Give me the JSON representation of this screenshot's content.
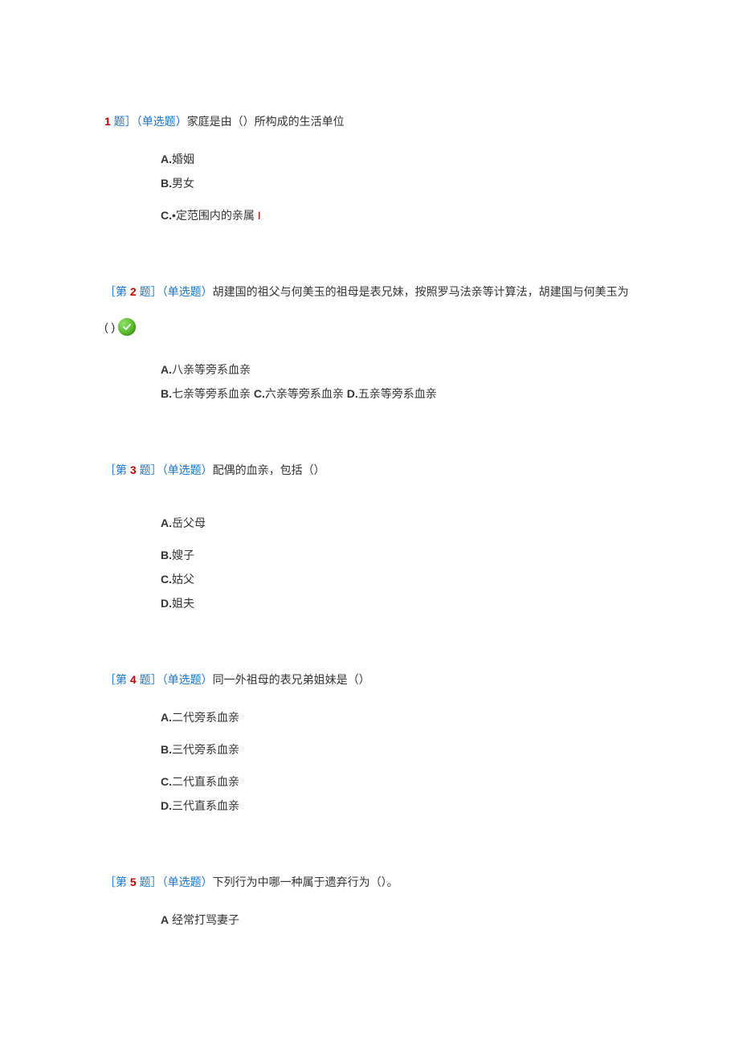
{
  "questions": [
    {
      "number_prefix": "",
      "number": "1",
      "number_suffix": " 题］（",
      "type": "单选题",
      "type_close": "）",
      "text": "家庭是由（）所构成的生活单位",
      "layout": "block",
      "options": [
        {
          "label": "A.",
          "text": "婚姻"
        },
        {
          "label": "B.",
          "text": "男女"
        },
        {
          "label": "C.",
          "text": "•定范围内的亲属",
          "trail": " I"
        }
      ]
    },
    {
      "number_prefix": "［第 ",
      "number": "2",
      "number_suffix": " 题］（",
      "type": "单选题",
      "type_close": "）",
      "text": "胡建国的祖父与何美玉的祖母是表兄妹，按照罗马法亲等计算法，胡建国与何美玉为",
      "check": true,
      "paren": "( )",
      "layout": "mixed",
      "options": [
        {
          "label": "A.",
          "text": "八亲等旁系血亲"
        },
        {
          "label": "B.",
          "text": "七亲等旁系血亲"
        },
        {
          "label": "C.",
          "text": "六亲等旁系血亲"
        },
        {
          "label": "D.",
          "text": "五亲等旁系血亲"
        }
      ]
    },
    {
      "number_prefix": "［第 ",
      "number": "3",
      "number_suffix": " 题］（",
      "type": "单选题",
      "type_close": "）",
      "text": "配偶的血亲，包括（）",
      "layout": "block",
      "options": [
        {
          "label": "A.",
          "text": "岳父母"
        },
        {
          "label": "B.",
          "text": "嫂子"
        },
        {
          "label": "C.",
          "text": "姑父"
        },
        {
          "label": "D.",
          "text": "姐夫"
        }
      ]
    },
    {
      "number_prefix": "［第 ",
      "number": "4",
      "number_suffix": " 题］（",
      "type": "单选题",
      "type_close": "）",
      "text": "同一外祖母的表兄弟姐妹是（）",
      "layout": "spaced",
      "options": [
        {
          "label": "A.",
          "text": "二代旁系血亲"
        },
        {
          "label": "B.",
          "text": "三代旁系血亲"
        },
        {
          "label": "C.",
          "text": "二代直系血亲"
        },
        {
          "label": "D.",
          "text": "三代直系血亲"
        }
      ]
    },
    {
      "number_prefix": "［第 ",
      "number": "5",
      "number_suffix": " 题］（",
      "type": "单选题",
      "type_close": "）",
      "text": "下列行为中哪一种属于遗弃行为（）。",
      "layout": "block",
      "options": [
        {
          "label": "A",
          "text": " 经常打骂妻子"
        }
      ]
    }
  ]
}
